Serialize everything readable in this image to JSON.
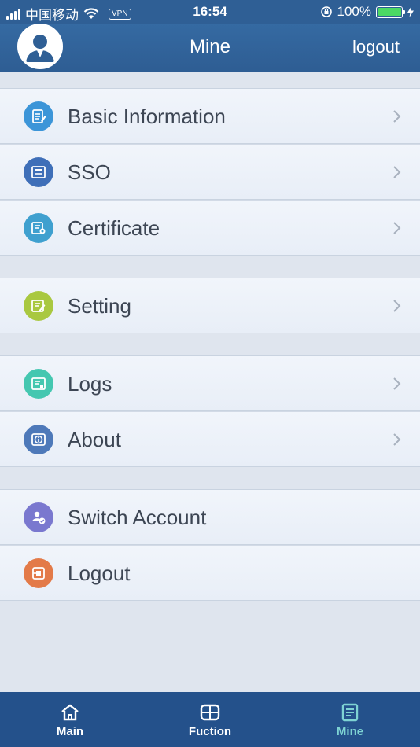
{
  "status_bar": {
    "carrier": "中国移动",
    "vpn": "VPN",
    "time": "16:54",
    "battery": "100%"
  },
  "header": {
    "title": "Mine",
    "logout_label": "logout"
  },
  "groups": [
    [
      {
        "label": "Basic Information",
        "icon": "document-icon",
        "color": "#3c95d8"
      },
      {
        "label": "SSO",
        "icon": "sso-card-icon",
        "color": "#3f6fb8"
      },
      {
        "label": "Certificate",
        "icon": "certificate-icon",
        "color": "#3fa0cf"
      }
    ],
    [
      {
        "label": "Setting",
        "icon": "setting-icon",
        "color": "#a9c840"
      }
    ],
    [
      {
        "label": "Logs",
        "icon": "logs-icon",
        "color": "#44c7b0"
      },
      {
        "label": "About",
        "icon": "about-icon",
        "color": "#4e79b9"
      }
    ],
    [
      {
        "label": "Switch Account",
        "icon": "switch-account-icon",
        "color": "#7a78cf"
      },
      {
        "label": "Logout",
        "icon": "logout-icon",
        "color": "#e37a48"
      }
    ]
  ],
  "tabs": [
    {
      "label": "Main",
      "icon": "home-icon",
      "active": false
    },
    {
      "label": "Fuction",
      "icon": "function-icon",
      "active": false
    },
    {
      "label": "Mine",
      "icon": "mine-icon",
      "active": true
    }
  ],
  "colors": {
    "nav_bg": "#2f5f95",
    "tab_bg": "#24518b",
    "tab_active": "#7ed3d3",
    "battery": "#4cd964"
  }
}
